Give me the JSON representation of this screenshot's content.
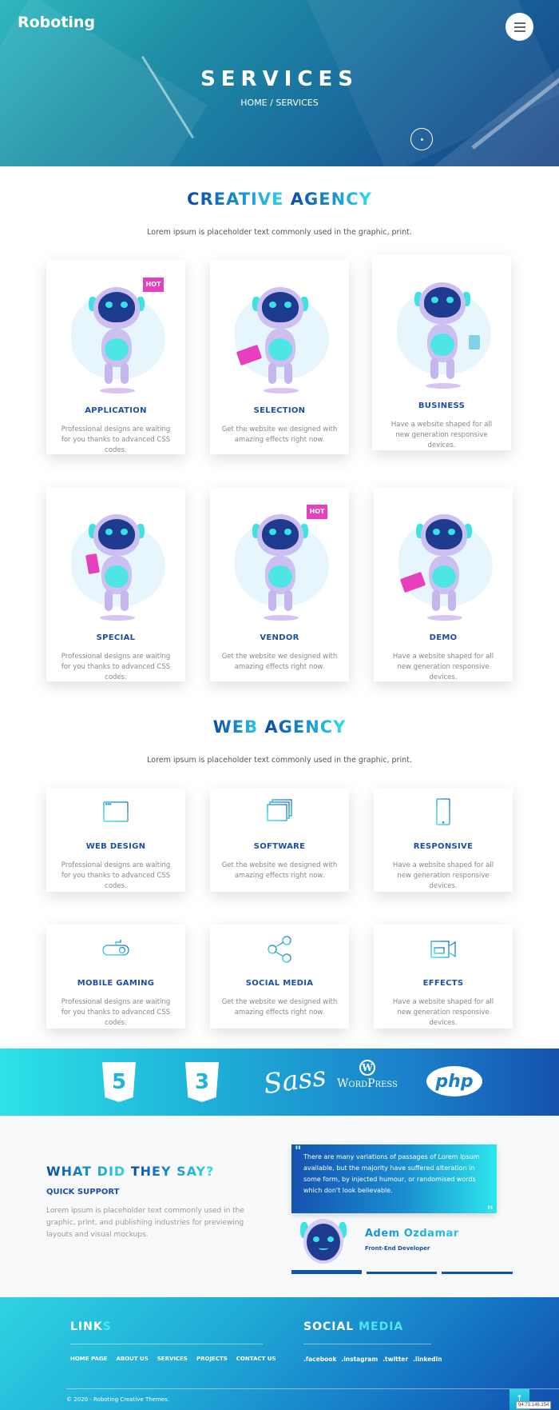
{
  "header": {
    "logo": "Roboting",
    "menu_icon": "hamburger-menu-icon",
    "title": "SERVICES",
    "breadcrumb": {
      "home": "HOME",
      "separator": "/",
      "current": "SERVICES"
    }
  },
  "creative": {
    "title_a": "CREATIVE ",
    "title_b": "AGENCY",
    "subtitle": "Lorem ipsum is placeholder text commonly used in the graphic, print.",
    "cards": [
      {
        "title": "APPLICATION",
        "text": "Professional designs are waiting for you thanks to advanced CSS codes.",
        "badge": "HOT",
        "illustration": "robot-waving"
      },
      {
        "title": "SELECTION",
        "text": "Get the website we designed with amazing effects right now.",
        "illustration": "robot-envelope"
      },
      {
        "title": "BUSINESS",
        "text": "Have a website shaped for all new generation responsive devices.",
        "illustration": "robot-money"
      },
      {
        "title": "SPECIAL",
        "text": "Professional designs are waiting for you thanks to advanced CSS codes.",
        "illustration": "robot-phone"
      },
      {
        "title": "VENDOR",
        "text": "Get the website we designed with amazing effects right now.",
        "badge": "HOT",
        "illustration": "robot-waving"
      },
      {
        "title": "DEMO",
        "text": "Have a website shaped for all new generation responsive devices.",
        "illustration": "robot-envelope"
      }
    ]
  },
  "web": {
    "title_a": "WEB ",
    "title_b": "AGENCY",
    "subtitle": "Lorem ipsum is placeholder text commonly used in the graphic, print.",
    "cards": [
      {
        "title": "WEB DESIGN",
        "text": "Professional designs are waiting for you thanks to advanced CSS codes.",
        "icon": "browser-window-icon"
      },
      {
        "title": "SOFTWARE",
        "text": "Get the website we designed with amazing effects right now.",
        "icon": "stacked-windows-icon"
      },
      {
        "title": "RESPONSIVE",
        "text": "Have a website shaped for all new generation responsive devices.",
        "icon": "mobile-phone-icon"
      },
      {
        "title": "MOBILE GAMING",
        "text": "Professional designs are waiting for you thanks to advanced CSS codes.",
        "icon": "gamepad-icon"
      },
      {
        "title": "SOCIAL MEDIA",
        "text": "Get the website we designed with amazing effects right now.",
        "icon": "share-icon"
      },
      {
        "title": "EFFECTS",
        "text": "Have a website shaped for all new generation responsive devices.",
        "icon": "video-camera-icon"
      }
    ]
  },
  "tech": {
    "html5": "5",
    "css3": "3",
    "sass": "Sass",
    "wordpress": "WordPress",
    "wordpress_mark": "W",
    "php": "php"
  },
  "testimonial": {
    "title_a": "WHAT DID ",
    "title_b": "THEY SAY?",
    "subtitle": "QUICK SUPPORT",
    "text": "Lorem ipsum is placeholder text commonly used in the graphic, print, and publishing industries for previewing layouts and visual mockups.",
    "quote": "There are many variations of passages of Lorem Ipsum available, but the majority have suffered alteration in some form, by injected humour, or randomised words which don't look believable.",
    "quote_mark": "\"",
    "name": "Adem Özdamar",
    "role": "Front-End Developer",
    "active_slide": 1,
    "slide_count": 3
  },
  "footer": {
    "links_title_a": "LINK",
    "links_title_b": "S",
    "links": [
      "HOME PAGE",
      "ABOUT US",
      "SERVICES",
      "PROJECTS",
      "CONTACT US"
    ],
    "social_title_a": "SOCIAL ",
    "social_title_b": "MEDIA",
    "social": [
      ".facebook",
      ".instagram",
      ".twitter",
      ".linkedin"
    ],
    "copyright": "© 2020 - Roboting Creative Themes.",
    "to_top": "↑",
    "ip": "94.73.146.154"
  },
  "colors": {
    "brand_dark": "#1c4fa5",
    "brand_cyan": "#2fe0ea",
    "text_gray": "#888888"
  }
}
